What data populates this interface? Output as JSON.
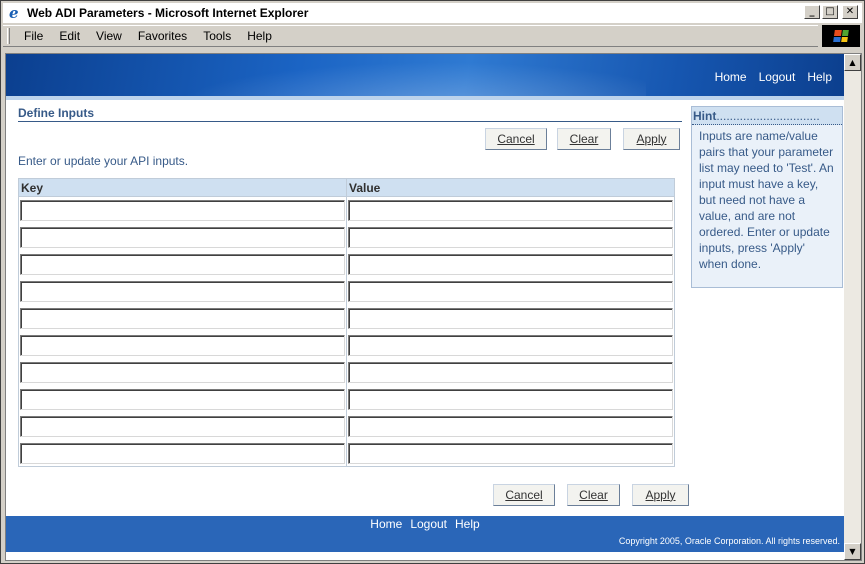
{
  "window": {
    "title": "Web ADI Parameters - Microsoft Internet Explorer",
    "controls": {
      "minimize": "_",
      "maximize": "□",
      "close": "✕"
    }
  },
  "menubar": {
    "items": [
      "File",
      "Edit",
      "View",
      "Favorites",
      "Tools",
      "Help"
    ]
  },
  "global_links": [
    "Home",
    "Logout",
    "Help"
  ],
  "page": {
    "title": "Define Inputs",
    "instructions": "Enter or update your API inputs.",
    "buttons": {
      "cancel": "Cancel",
      "clear": "Clear",
      "apply": "Apply"
    }
  },
  "table": {
    "headers": {
      "key": "Key",
      "value": "Value"
    },
    "rows": [
      {
        "key": "",
        "value": ""
      },
      {
        "key": "",
        "value": ""
      },
      {
        "key": "",
        "value": ""
      },
      {
        "key": "",
        "value": ""
      },
      {
        "key": "",
        "value": ""
      },
      {
        "key": "",
        "value": ""
      },
      {
        "key": "",
        "value": ""
      },
      {
        "key": "",
        "value": ""
      },
      {
        "key": "",
        "value": ""
      },
      {
        "key": "",
        "value": ""
      }
    ]
  },
  "hint": {
    "title": "Hint",
    "dots": "...............................",
    "text": "Inputs are name/value pairs that your parameter list may need to 'Test'. An input must have a key, but need not have a value, and are not ordered. Enter or update inputs, press 'Apply' when done."
  },
  "footer": {
    "links": [
      "Home",
      "Logout",
      "Help"
    ],
    "copyright": "Copyright 2005, Oracle Corporation. All rights reserved."
  },
  "colors": {
    "banner": "#1b64c4",
    "footer": "#2a66b8",
    "header_text": "#375a88",
    "table_header": "#cfe0f1"
  }
}
